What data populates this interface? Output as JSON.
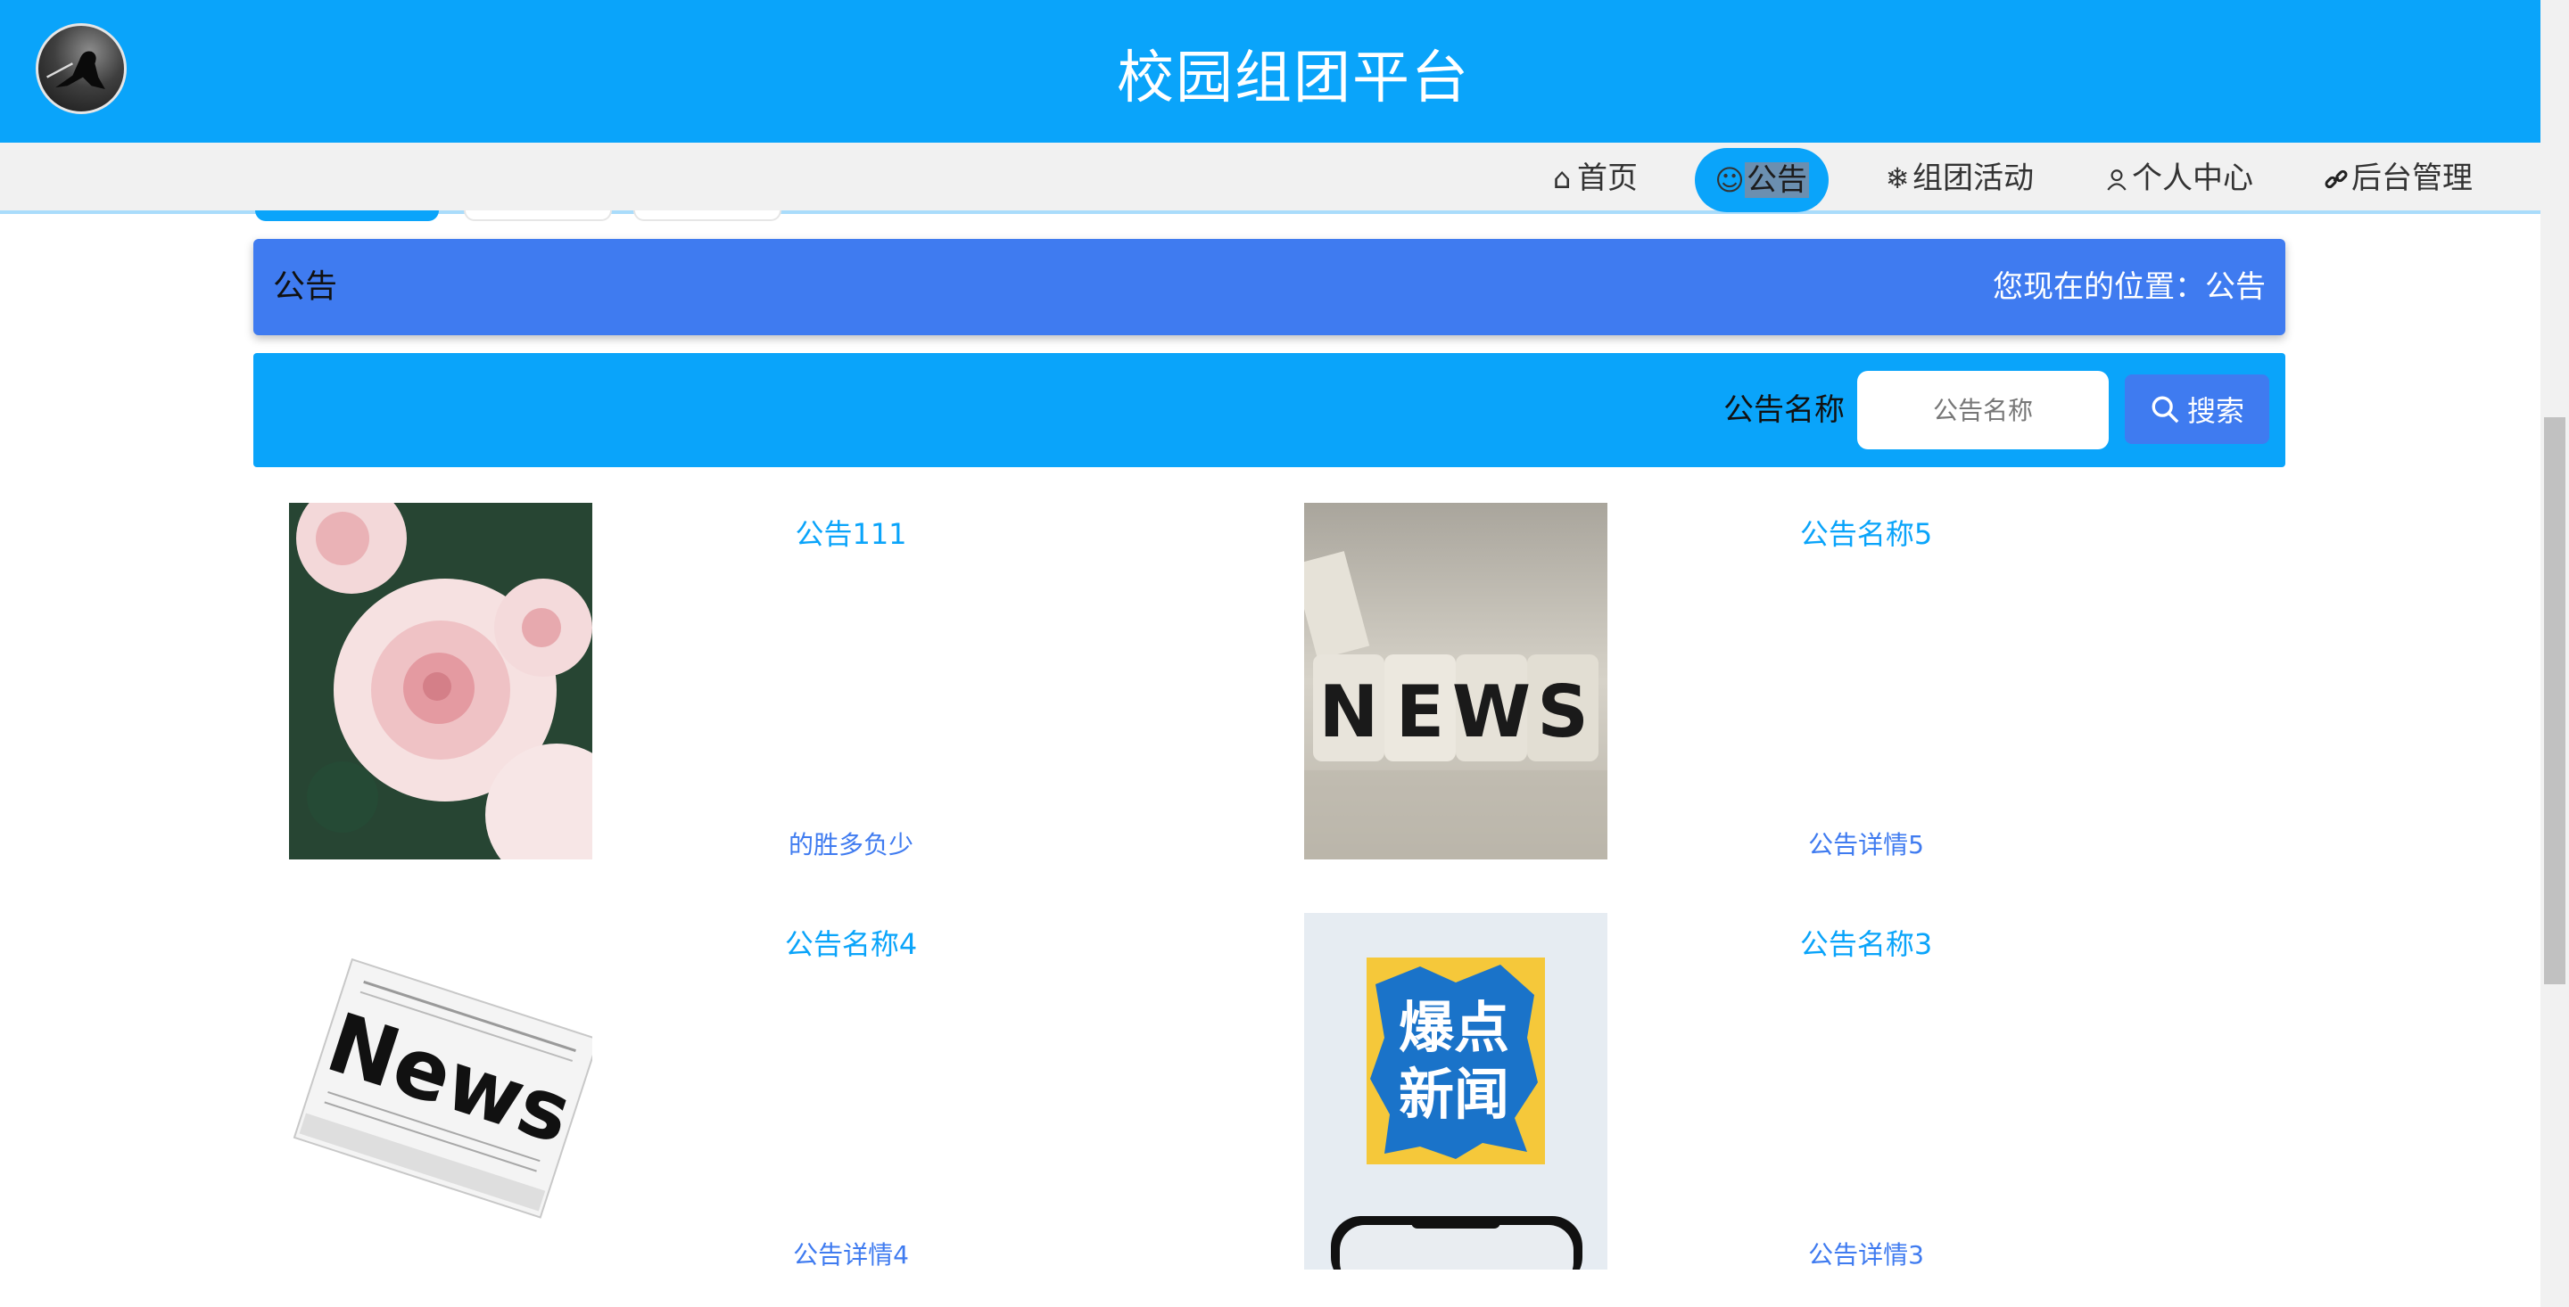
{
  "header": {
    "title": "校园组团平台",
    "brand_color": "#0aa4fa"
  },
  "nav": {
    "items": [
      {
        "icon": "home-icon",
        "label": "首页"
      },
      {
        "icon": "smile-icon",
        "label": "公告",
        "active": true
      },
      {
        "icon": "snowflake-icon",
        "label": "组团活动"
      },
      {
        "icon": "user-icon",
        "label": "个人中心"
      },
      {
        "icon": "link-icon",
        "label": "后台管理"
      }
    ]
  },
  "breadcrumb": {
    "title": "公告",
    "position_label": "您现在的位置：",
    "position_value": "公告",
    "color": "#3f7bf0"
  },
  "search": {
    "label": "公告名称",
    "placeholder": "公告名称",
    "button_label": "搜索"
  },
  "notices": [
    {
      "title": "公告111",
      "desc": "的胜多负少",
      "image": "pink-roses"
    },
    {
      "title": "公告名称5",
      "desc": "公告详情5",
      "image": "news-blocks"
    },
    {
      "title": "公告名称4",
      "desc": "公告详情4",
      "image": "news-newspaper"
    },
    {
      "title": "公告名称3",
      "desc": "公告详情3",
      "image": "breaking-news-phone"
    }
  ],
  "image_text": {
    "news_blocks": [
      "N",
      "E",
      "W",
      "S"
    ],
    "newspaper": "News",
    "breaking_news": [
      "爆点",
      "新闻"
    ]
  }
}
